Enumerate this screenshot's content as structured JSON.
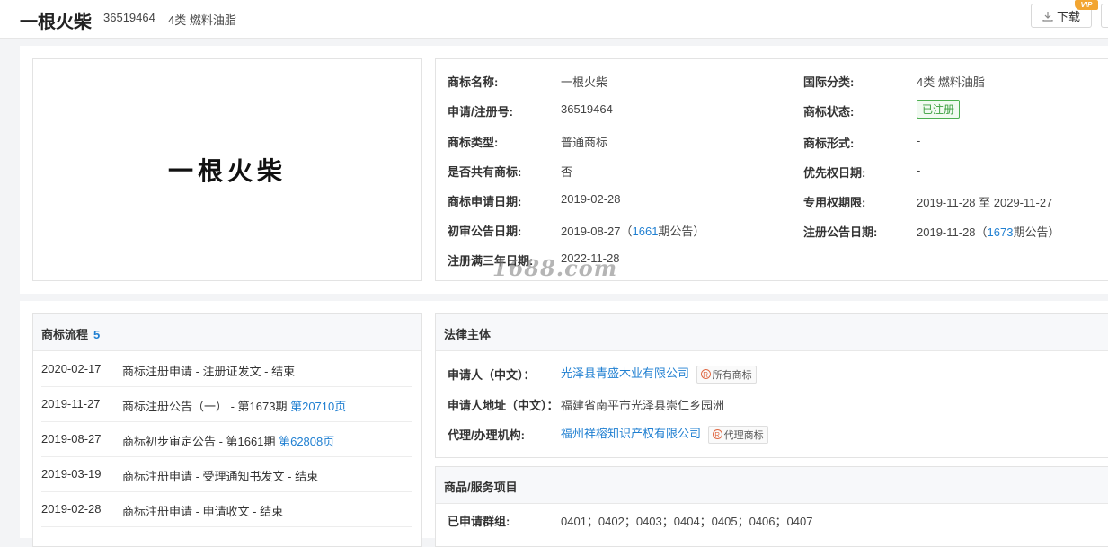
{
  "header": {
    "title": "一根火柴",
    "reg_no": "36519464",
    "class_text": "4类 燃料油脂",
    "download_label": "下载",
    "vip_label": "VIP"
  },
  "logo": {
    "text": "一根火柴"
  },
  "info": {
    "left": [
      {
        "label": "商标名称:",
        "value": "一根火柴"
      },
      {
        "label": "申请/注册号:",
        "value": "36519464"
      },
      {
        "label": "商标类型:",
        "value": "普通商标"
      },
      {
        "label": "是否共有商标:",
        "value": "否"
      },
      {
        "label": "商标申请日期:",
        "value": "2019-02-28"
      },
      {
        "label": "初审公告日期:",
        "value_pre": "2019-08-27（",
        "value_link": "1661",
        "value_post": "期公告）"
      },
      {
        "label": "注册满三年日期:",
        "value": "2022-11-28"
      }
    ],
    "right": [
      {
        "label": "国际分类:",
        "value": "4类 燃料油脂"
      },
      {
        "label": "商标状态:",
        "badge": "已注册"
      },
      {
        "label": "商标形式:",
        "value": "-"
      },
      {
        "label": "优先权日期:",
        "value": "-"
      },
      {
        "label": "专用权期限:",
        "value": "2019-11-28 至 2029-11-27"
      },
      {
        "label": "注册公告日期:",
        "value_pre": "2019-11-28（",
        "value_link": "1673",
        "value_post": "期公告）"
      }
    ]
  },
  "watermark": "1688.com",
  "flow": {
    "title": "商标流程",
    "count": "5",
    "rows": [
      {
        "date": "2020-02-17",
        "text": "商标注册申请 - 注册证发文 - 结束",
        "link": ""
      },
      {
        "date": "2019-11-27",
        "text": "商标注册公告（一） - 第1673期 ",
        "link": "第20710页"
      },
      {
        "date": "2019-08-27",
        "text": "商标初步审定公告 - 第1661期 ",
        "link": "第62808页"
      },
      {
        "date": "2019-03-19",
        "text": "商标注册申请 - 受理通知书发文 - 结束",
        "link": ""
      },
      {
        "date": "2019-02-28",
        "text": "商标注册申请 - 申请收文 - 结束",
        "link": ""
      }
    ]
  },
  "legal": {
    "title": "法律主体",
    "applicant_label": "申请人（中文）：",
    "applicant": "光泽县青盛木业有限公司",
    "applicant_tag": "所有商标",
    "address_label": "申请人地址（中文）：",
    "address": "福建省南平市光泽县崇仁乡园洲",
    "agent_label": "代理/办理机构:",
    "agent": "福州祥榕知识产权有限公司",
    "agent_tag": "代理商标"
  },
  "goods": {
    "title": "商品/服务项目",
    "group_label": "已申请群组:",
    "groups": "0401；0402；0403；0404；0405；0406；0407"
  },
  "colors": {
    "link": "#1f7fd1",
    "status_green": "#3a9f3e",
    "vip": "#f2a531"
  }
}
